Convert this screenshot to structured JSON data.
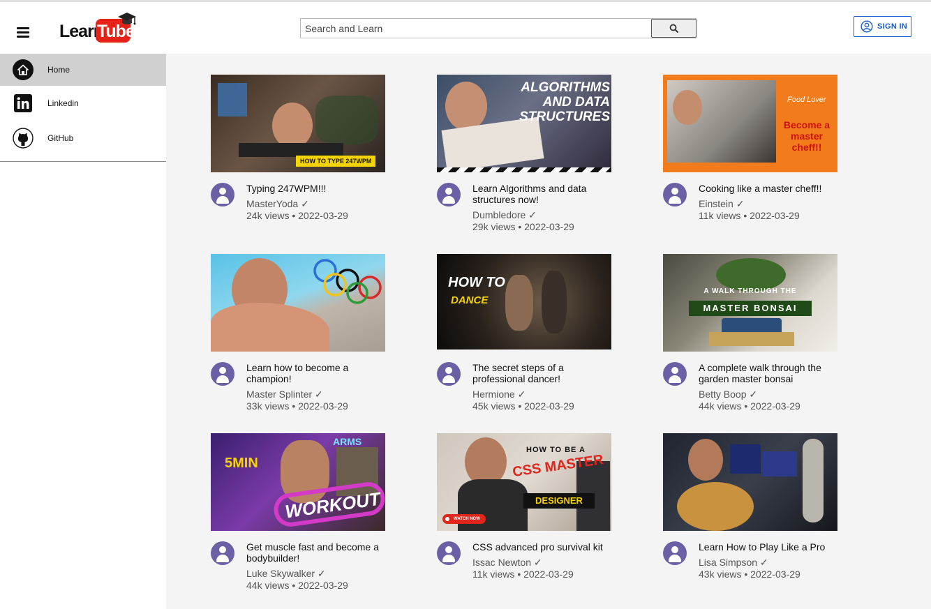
{
  "app": {
    "logo_left": "Learn",
    "logo_right": "Tube"
  },
  "search": {
    "placeholder": "Search and Learn"
  },
  "auth": {
    "signin_label": "SIGN IN"
  },
  "sidebar": {
    "items": [
      {
        "label": "Home",
        "icon": "home-icon",
        "active": true
      },
      {
        "label": "Linkedin",
        "icon": "linkedin-icon",
        "active": false
      },
      {
        "label": "GitHub",
        "icon": "github-icon",
        "active": false
      }
    ]
  },
  "videos": [
    {
      "title": "Typing 247WPM!!!",
      "channel": "MasterYoda ✓",
      "stats": "24k views • 2022-03-29",
      "thumb_text": "HOW TO TYPE 247WPM"
    },
    {
      "title": "Learn Algorithms and data structures now!",
      "channel": "Dumbledore ✓",
      "stats": "29k views • 2022-03-29",
      "thumb_text": "ALGORITHMS AND DATA STRUCTURES"
    },
    {
      "title": "Cooking like a master cheff!!",
      "channel": "Einstein ✓",
      "stats": "11k views • 2022-03-29",
      "thumb_text": "Food Lover",
      "thumb_text2": "Become a master cheff!!"
    },
    {
      "title": "Learn how to become a champion!",
      "channel": "Master Splinter ✓",
      "stats": "33k views • 2022-03-29"
    },
    {
      "title": "The secret steps of a professional dancer!",
      "channel": "Hermione ✓",
      "stats": "45k views • 2022-03-29",
      "thumb_text": "HOW TO",
      "thumb_text2": "DANCE"
    },
    {
      "title": "A complete walk through the garden master bonsai",
      "channel": "Betty Boop ✓",
      "stats": "44k views • 2022-03-29",
      "thumb_text": "A WALK THROUGH THE",
      "thumb_text2": "MASTER BONSAI"
    },
    {
      "title": "Get muscle fast and become a bodybuilder!",
      "channel": "Luke Skywalker ✓",
      "stats": "44k views • 2022-03-29",
      "thumb_text": "5MIN",
      "thumb_text2": "WORKOUT",
      "thumb_text3": "ARMS"
    },
    {
      "title": "CSS advanced pro survival kit",
      "channel": "Issac Newton ✓",
      "stats": "11k views • 2022-03-29",
      "thumb_text": "HOW TO BE A",
      "thumb_text2": "CSS MASTER",
      "thumb_text3": "DESIGNER",
      "thumb_text4": "WATCH NOW"
    },
    {
      "title": "Learn How to Play Like a Pro",
      "channel": "Lisa Simpson ✓",
      "stats": "43k views • 2022-03-29"
    }
  ],
  "colors": {
    "brand_red": "#e62117",
    "accent_blue": "#1a5bd0",
    "avatar_purple": "#6b5fa5",
    "sidebar_active": "#d0d0d0",
    "main_bg": "#f4f4f4"
  }
}
